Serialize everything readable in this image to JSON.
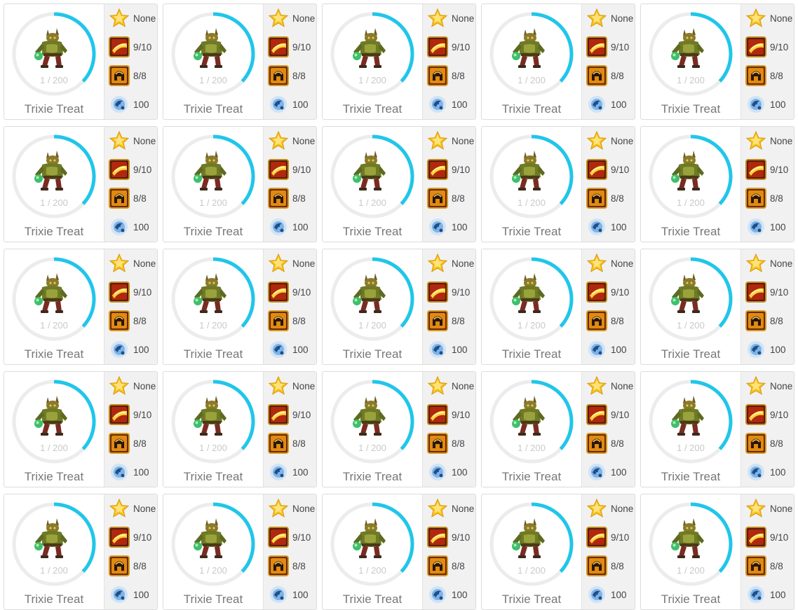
{
  "monster": {
    "name": "Trixie Treat",
    "level_text": "1 / 200",
    "level_progress": 0.37
  },
  "stats": {
    "star": {
      "icon": "star-icon",
      "value": "None"
    },
    "skill": {
      "icon": "skill-icon",
      "value": "9/10"
    },
    "armor": {
      "icon": "helmet-icon",
      "value": "8/8"
    },
    "power": {
      "icon": "power-orb-icon",
      "value": "100"
    }
  },
  "colors": {
    "ring_track": "#ececec",
    "ring_progress": "#20c6ea",
    "stat_panel": "#f1f1f1"
  }
}
